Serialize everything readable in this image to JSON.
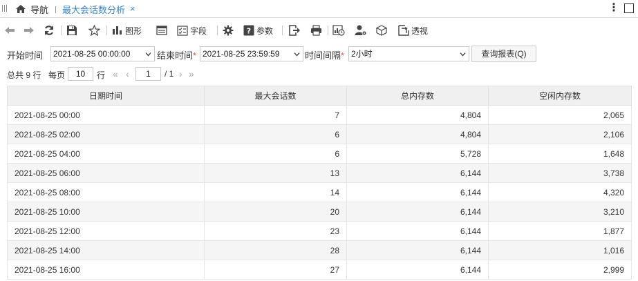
{
  "tabbar": {
    "home_label": "导航",
    "active_tab_label": "最大会话数分析",
    "close_glyph": "×",
    "more_glyph": "⋮"
  },
  "toolbar": {
    "chart_label": "图形",
    "fields_label": "字段",
    "params_label": "参数",
    "pivot_label": "透视"
  },
  "filter": {
    "start_label": "开始时间",
    "start_value": "2021-08-25 00:00:00",
    "end_label": "结束时间",
    "end_value": "2021-08-25 23:59:59",
    "interval_label": "时间间隔",
    "interval_value": "2小时",
    "required_mark": "*",
    "query_button": "查询报表(Q)"
  },
  "pager": {
    "total_text": "总共 9 行",
    "per_page_label": "每页",
    "per_page_value": "10",
    "rows_unit": "行",
    "current_page": "1",
    "total_pages_text": "/ 1"
  },
  "table": {
    "columns": [
      "日期时间",
      "最大会话数",
      "总内存数",
      "空闲内存数"
    ],
    "rows": [
      [
        "2021-08-25  00:00",
        "7",
        "4,804",
        "2,065"
      ],
      [
        "2021-08-25  02:00",
        "6",
        "4,804",
        "2,106"
      ],
      [
        "2021-08-25  04:00",
        "6",
        "5,728",
        "1,648"
      ],
      [
        "2021-08-25  06:00",
        "13",
        "6,144",
        "3,738"
      ],
      [
        "2021-08-25  08:00",
        "14",
        "6,144",
        "4,320"
      ],
      [
        "2021-08-25  10:00",
        "20",
        "6,144",
        "3,210"
      ],
      [
        "2021-08-25  12:00",
        "23",
        "6,144",
        "1,877"
      ],
      [
        "2021-08-25  14:00",
        "28",
        "6,144",
        "1,016"
      ],
      [
        "2021-08-25  16:00",
        "27",
        "6,144",
        "2,999"
      ]
    ]
  },
  "colors": {
    "accent": "#3b82c4",
    "required": "#d9534f",
    "header_bg": "#f0f0f0",
    "alt_row_bg": "#f5f5f5"
  }
}
